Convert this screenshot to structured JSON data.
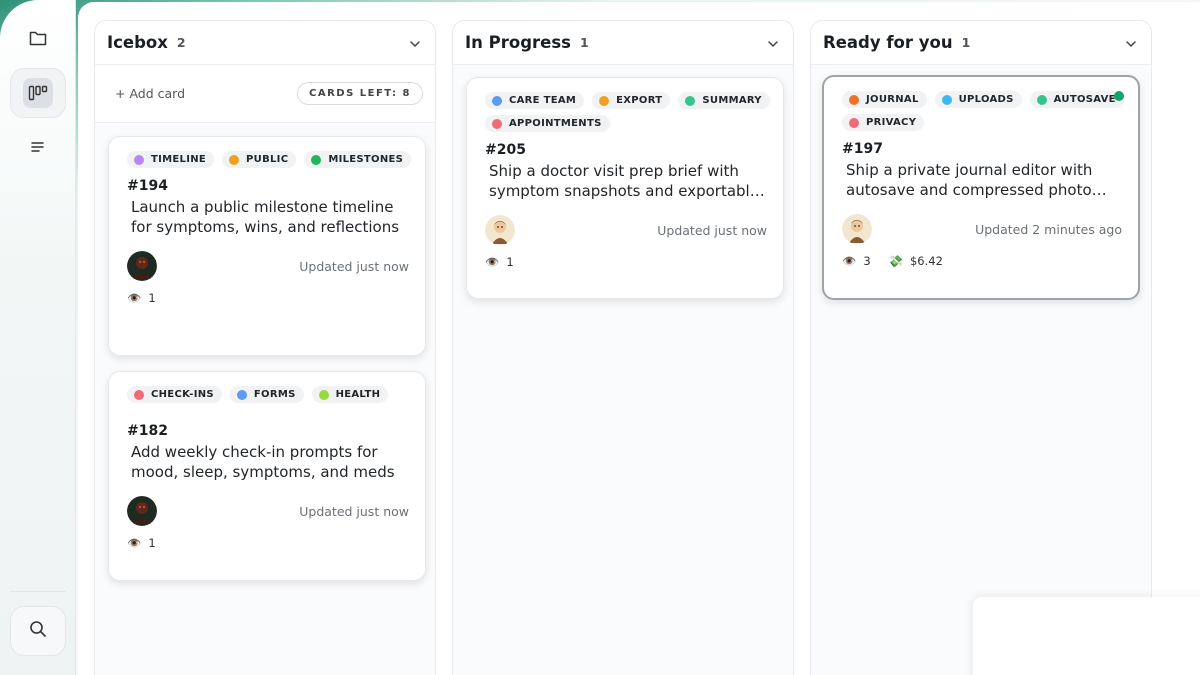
{
  "sidebar": {
    "items": [
      {
        "name": "folder-icon"
      },
      {
        "name": "board-icon",
        "active": true
      },
      {
        "name": "list-icon"
      },
      {
        "name": "search-icon"
      }
    ]
  },
  "columns": [
    {
      "title": "Icebox",
      "count": "2",
      "add_card": "+ Add card",
      "cards_left": "CARDS LEFT: 8",
      "cards": [
        {
          "tags": [
            {
              "label": "TIMELINE",
              "color": "#b985f2"
            },
            {
              "label": "PUBLIC",
              "color": "#f0a020"
            },
            {
              "label": "MILESTONES",
              "color": "#22b45a"
            }
          ],
          "number": "#194",
          "title": "Launch a public milestone timeline for symptoms, wins, and reflections",
          "updated": "Updated just now",
          "views": "1"
        },
        {
          "tags": [
            {
              "label": "CHECK-INS",
              "color": "#f06a78"
            },
            {
              "label": "FORMS",
              "color": "#5b9bf0"
            },
            {
              "label": "HEALTH",
              "color": "#9bd83a"
            }
          ],
          "number": "#182",
          "title": "Add weekly check-in prompts for mood, sleep, symptoms, and meds",
          "updated": "Updated just now",
          "views": "1"
        }
      ]
    },
    {
      "title": "In Progress",
      "count": "1",
      "cards": [
        {
          "tags": [
            {
              "label": "CARE TEAM",
              "color": "#5b9bf0"
            },
            {
              "label": "EXPORT",
              "color": "#f0a020"
            },
            {
              "label": "SUMMARY",
              "color": "#35c48e"
            },
            {
              "label": "APPOINTMENTS",
              "color": "#f06a78"
            }
          ],
          "number": "#205",
          "title": "Ship a doctor visit prep brief with symptom snapshots and exportabl…",
          "updated": "Updated just now",
          "views": "1"
        }
      ]
    },
    {
      "title": "Ready for you",
      "count": "1",
      "cards": [
        {
          "tags": [
            {
              "label": "JOURNAL",
              "color": "#f07028"
            },
            {
              "label": "UPLOADS",
              "color": "#3fb8f0"
            },
            {
              "label": "AUTOSAVE",
              "color": "#35c48e"
            },
            {
              "label": "PRIVACY",
              "color": "#f06a78"
            }
          ],
          "number": "#197",
          "title": "Ship a private journal editor with autosave and compressed photo…",
          "updated": "Updated 2 minutes ago",
          "views": "3",
          "cost": "$6.42"
        }
      ]
    }
  ]
}
